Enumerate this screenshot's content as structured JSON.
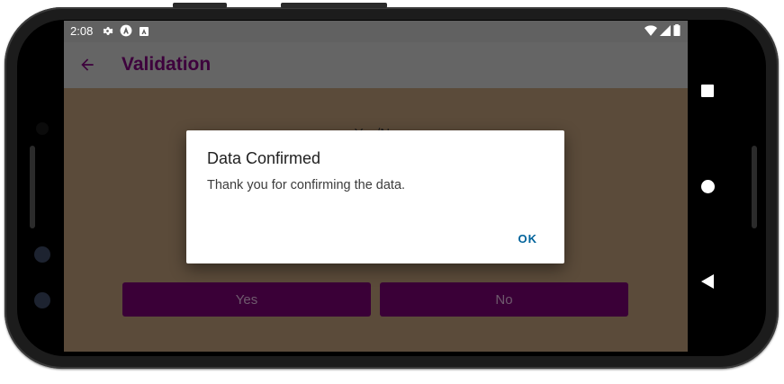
{
  "status_bar": {
    "time": "2:08",
    "left_icons": [
      "gear-icon",
      "a-circle-icon",
      "a-square-icon"
    ],
    "right_icons": [
      "wifi-icon",
      "signal-icon",
      "battery-icon"
    ]
  },
  "app_bar": {
    "title": "Validation",
    "back_icon": "arrow-left-icon",
    "title_color": "#3d003c"
  },
  "content": {
    "question_text": "Yes/No",
    "buttons": [
      {
        "label": "Yes"
      },
      {
        "label": "No"
      }
    ]
  },
  "dialog": {
    "title": "Data Confirmed",
    "message": "Thank you for confirming the data.",
    "ok_label": "OK",
    "accent_color": "#00639b"
  },
  "nav_bar": {
    "buttons": [
      "recents-icon",
      "home-icon",
      "back-icon"
    ]
  }
}
